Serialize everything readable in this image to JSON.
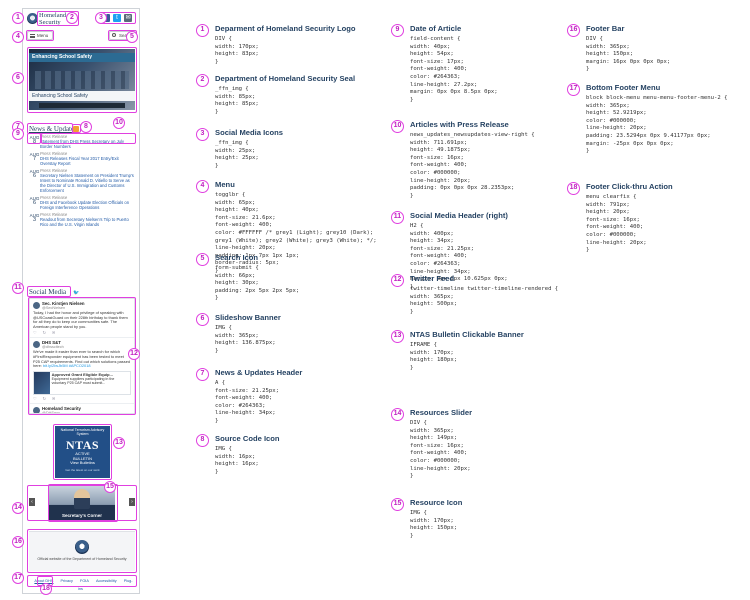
{
  "mockup": {
    "logo_line1": "Homeland",
    "logo_line2": "Security",
    "social_icons": [
      "f",
      "t",
      "✉"
    ],
    "menu_label": "Menu",
    "search_label": "Search",
    "slideshow": {
      "bar_text": "Enhancing School Safety",
      "caption": "Enhancing School Safety"
    },
    "news_header": "News & Updates",
    "news": [
      {
        "month": "AUG",
        "day": "8",
        "category": "Press Release",
        "title": "Statement from DHS Press Secretary on July Border Numbers"
      },
      {
        "month": "AUG",
        "day": "7",
        "category": "Press Release",
        "title": "DHS Releases Fiscal Year 2017 Entry/Exit Overstay Report"
      },
      {
        "month": "AUG",
        "day": "6",
        "category": "Press Release",
        "title": "Secretary Nielsen Statement on President Trump's Intent to Nominate Ronald D. Vitiello to Serve as the Director of U.S. Immigration and Customs Enforcement"
      },
      {
        "month": "AUG",
        "day": "6",
        "category": "Press Release",
        "title": "DHS and Facebook Update Election Officials on Foreign Interference Operations"
      },
      {
        "month": "AUG",
        "day": "3",
        "category": "Press Release",
        "title": "Readout from Secretary Nielsen's Trip to Puerto Rico and the U.S. Virgin Islands"
      }
    ],
    "social_header": "Social Media",
    "tweets": [
      {
        "name": "Sec. Kirstjen Nielsen",
        "handle": "@SecNielsen",
        "text": "Today, I had the honor and privilege of speaking with @USCoastGuard on their 228th birthday to thank them for all they do to keep our communities safe. The American people stand by you.",
        "link": "",
        "has_card": false,
        "card_title": "",
        "card_text": ""
      },
      {
        "name": "DHS S&T",
        "handle": "@dhsscitech",
        "text": "We've made it easier than ever to search for which #FirstResponder equipment has been tested to meet P25 CAP requirements. Find out which solutions passed here:",
        "link": "bit.ly/2IwJb5M #APCO2018",
        "has_card": true,
        "card_title": "Approved Grant Eligible Equip...",
        "card_text": "Equipment suppliers participating in the voluntary P25 CAP must submit..."
      },
      {
        "name": "Homeland Security",
        "handle": "@DHSgov",
        "text": "",
        "link": "",
        "has_card": false,
        "card_title": "",
        "card_text": ""
      }
    ],
    "ntas": {
      "top": "National Terrorism Advisory System",
      "big": "NTAS",
      "sub1": "ACTIVE",
      "sub2": "BULLETIN",
      "sub3": "View Bulletins",
      "foot": "Get the latest on our work"
    },
    "resource_label": "Secretary's Corner",
    "footer_text": "Official website of the Department of Homeland Security",
    "footer_menu": [
      "About DHS",
      "Privacy",
      "FOIA",
      "Accessibility",
      "Plug-ins"
    ]
  },
  "specs": [
    {
      "num": "1",
      "title": "Deparment of Homeland Security Logo",
      "code": "DIV {\nwidth: 170px;\nheight: 83px;\n}"
    },
    {
      "num": "2",
      "title": "Department of Homeland Security Seal",
      "code": "_ffn_img {\nwidth: 85px;\nheight: 85px;\n}"
    },
    {
      "num": "3",
      "title": "Social Media Icons",
      "code": "_ffn_img {\nwidth: 25px;\nheight: 25px;\n}"
    },
    {
      "num": "4",
      "title": "Menu",
      "code": "togglbr {\nwidth: 65px;\nheight: 40px;\nfont-size: 21.6px;\nfont-weight: 400;\ncolor: #FFFFFF /* grey1 (Light); grey10 (Dark);\ngrey1 (White); grey2 (White); grey3 (White); */;\nline-height: 20px;\npadding: 1px 7px 1px 1px;\nborder-radius: 5px;\n}"
    },
    {
      "num": "5",
      "title": "Search Icon",
      "code": "form-submit {\nwidth: 66px;\nheight: 30px;\npadding: 2px 5px 2px 5px;\n}"
    },
    {
      "num": "6",
      "title": "Slideshow Banner",
      "code": "IMG {\nwidth: 365px;\nheight: 136.875px;\n}"
    },
    {
      "num": "7",
      "title": "News & Updates Header",
      "code": "A {\nfont-size: 21.25px;\nfont-weight: 400;\ncolor: #264363;\nline-height: 34px;\n}"
    },
    {
      "num": "8",
      "title": "Source Code Icon",
      "code": "IMG {\nwidth: 16px;\nheight: 16px;\n}"
    },
    {
      "num": "9",
      "title": "Date of Article",
      "code": "field-content {\nwidth: 40px;\nheight: 54px;\nfont-size: 17px;\nfont-weight: 400;\ncolor: #264363;\nline-height: 27.2px;\nmargin: 0px 0px 8.5px 0px;\n}"
    },
    {
      "num": "10",
      "title": "Articles with Press Release",
      "code": "news_updates_newsupdates-view-right {\nwidth: 711.691px;\nheight: 49.1875px;\nfont-size: 16px;\nfont-weight: 400;\ncolor: #000000;\nline-height: 20px;\npadding: 0px 0px 0px 28.2353px;\n}"
    },
    {
      "num": "11",
      "title": "Social Media Header (right)",
      "code": "H2 {\nwidth: 400px;\nheight: 34px;\nfont-size: 21.25px;\nfont-weight: 400;\ncolor: #264363;\nline-height: 34px;\nmargin: 0px 0px 10.625px 0px;\n}"
    },
    {
      "num": "12",
      "title": "Twitter Feed",
      "code": "twitter-timeline twitter-timeline-rendered {\nwidth: 365px;\nheight: 500px;\n}"
    },
    {
      "num": "13",
      "title": "NTAS Bulletin Clickable Banner",
      "code": "IFRAME {\nwidth: 170px;\nheight: 180px;\n}"
    },
    {
      "num": "14",
      "title": "Resources Slider",
      "code": "DIV {\nwidth: 365px;\nheight: 149px;\nfont-size: 16px;\nfont-weight: 400;\ncolor: #000000;\nline-height: 20px;\n}"
    },
    {
      "num": "15",
      "title": "Resource Icon",
      "code": "IMG {\nwidth: 170px;\nheight: 150px;\n}"
    },
    {
      "num": "16",
      "title": "Footer Bar",
      "code": "DIV {\nwidth: 365px;\nheight: 150px;\nmargin: 16px 0px 0px 0px;\n}"
    },
    {
      "num": "17",
      "title": "Bottom Footer Menu",
      "code": "block block-menu menu-menu-footer-menu-2 {\nwidth: 365px;\nheight: 52.9219px;\ncolor: #000000;\nline-height: 20px;\npadding: 23.5294px 0px 9.41177px 0px;\nmargin: -25px 0px 0px 0px;\n}"
    },
    {
      "num": "18",
      "title": "Footer Click-thru Action",
      "code": "menu clearfix {\nwidth: 791px;\nheight: 20px;\nfont-size: 16px;\nfont-weight: 400;\ncolor: #000000;\nline-height: 20px;\n}"
    }
  ],
  "phone_badges": [
    "1",
    "2",
    "3",
    "4",
    "5",
    "6",
    "7",
    "8",
    "9",
    "10",
    "11",
    "12",
    "13",
    "14",
    "15",
    "16",
    "17",
    "18"
  ],
  "colors": {
    "accent": "#e040e0",
    "brand": "#264363",
    "link": "#2059a6"
  }
}
